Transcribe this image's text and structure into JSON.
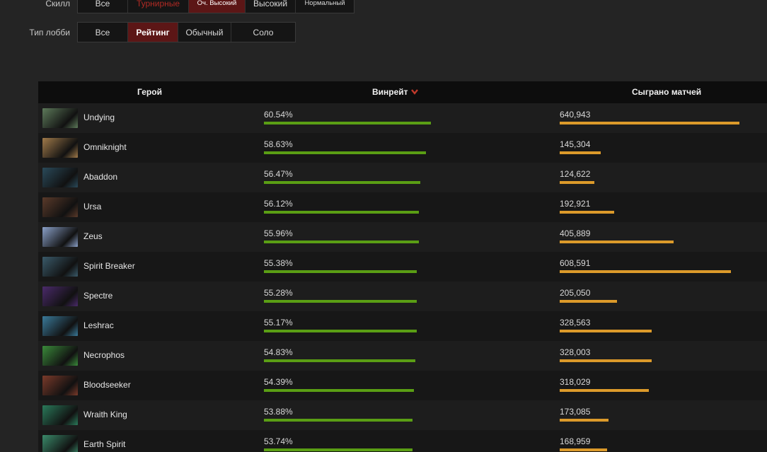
{
  "filters": {
    "skill": {
      "label": "Скилл",
      "options": [
        {
          "label": "Все"
        },
        {
          "label": "Турнирные"
        },
        {
          "label": "Оч. Высокий"
        },
        {
          "label": "Высокий"
        },
        {
          "label": "Нормальный"
        }
      ],
      "selected": "Оч. Высокий"
    },
    "lobby": {
      "label": "Тип лобби",
      "options": [
        {
          "label": "Все"
        },
        {
          "label": "Рейтинг"
        },
        {
          "label": "Обычный"
        },
        {
          "label": "Соло"
        }
      ],
      "selected": "Рейтинг"
    }
  },
  "table": {
    "headers": {
      "hero": "Герой",
      "winrate": "Винрейт",
      "matches": "Сыграно матчей"
    },
    "sort": {
      "column": "winrate",
      "direction": "desc",
      "icon": "chevron-down-icon",
      "color": "#c0392b"
    },
    "rows": [
      {
        "hero": "Undying",
        "winrate": "60.54%",
        "win_pct": 60.54,
        "matches": "640,943",
        "match_count": 640943,
        "portrait_color": "#5d7a5a"
      },
      {
        "hero": "Omniknight",
        "winrate": "58.63%",
        "win_pct": 58.63,
        "matches": "145,304",
        "match_count": 145304,
        "portrait_color": "#a07a4a"
      },
      {
        "hero": "Abaddon",
        "winrate": "56.47%",
        "win_pct": 56.47,
        "matches": "124,622",
        "match_count": 124622,
        "portrait_color": "#2a4a5a"
      },
      {
        "hero": "Ursa",
        "winrate": "56.12%",
        "win_pct": 56.12,
        "matches": "192,921",
        "match_count": 192921,
        "portrait_color": "#5a3a2a"
      },
      {
        "hero": "Zeus",
        "winrate": "55.96%",
        "win_pct": 55.96,
        "matches": "405,889",
        "match_count": 405889,
        "portrait_color": "#8aa0c8"
      },
      {
        "hero": "Spirit Breaker",
        "winrate": "55.38%",
        "win_pct": 55.38,
        "matches": "608,591",
        "match_count": 608591,
        "portrait_color": "#3a5a6a"
      },
      {
        "hero": "Spectre",
        "winrate": "55.28%",
        "win_pct": 55.28,
        "matches": "205,050",
        "match_count": 205050,
        "portrait_color": "#4a2a6a"
      },
      {
        "hero": "Leshrac",
        "winrate": "55.17%",
        "win_pct": 55.17,
        "matches": "328,563",
        "match_count": 328563,
        "portrait_color": "#3a7a9a"
      },
      {
        "hero": "Necrophos",
        "winrate": "54.83%",
        "win_pct": 54.83,
        "matches": "328,003",
        "match_count": 328003,
        "portrait_color": "#3a8a3a"
      },
      {
        "hero": "Bloodseeker",
        "winrate": "54.39%",
        "win_pct": 54.39,
        "matches": "318,029",
        "match_count": 318029,
        "portrait_color": "#7a3a2a"
      },
      {
        "hero": "Wraith King",
        "winrate": "53.88%",
        "win_pct": 53.88,
        "matches": "173,085",
        "match_count": 173085,
        "portrait_color": "#2a7a5a"
      },
      {
        "hero": "Earth Spirit",
        "winrate": "53.74%",
        "win_pct": 53.74,
        "matches": "168,959",
        "match_count": 168959,
        "portrait_color": "#3a8a6a"
      }
    ]
  },
  "colors": {
    "winrate_bar": "#5a9e14",
    "matches_bar": "#dc9a2a",
    "active_filter": "#5c1616",
    "tournament_text": "#b02a24"
  }
}
